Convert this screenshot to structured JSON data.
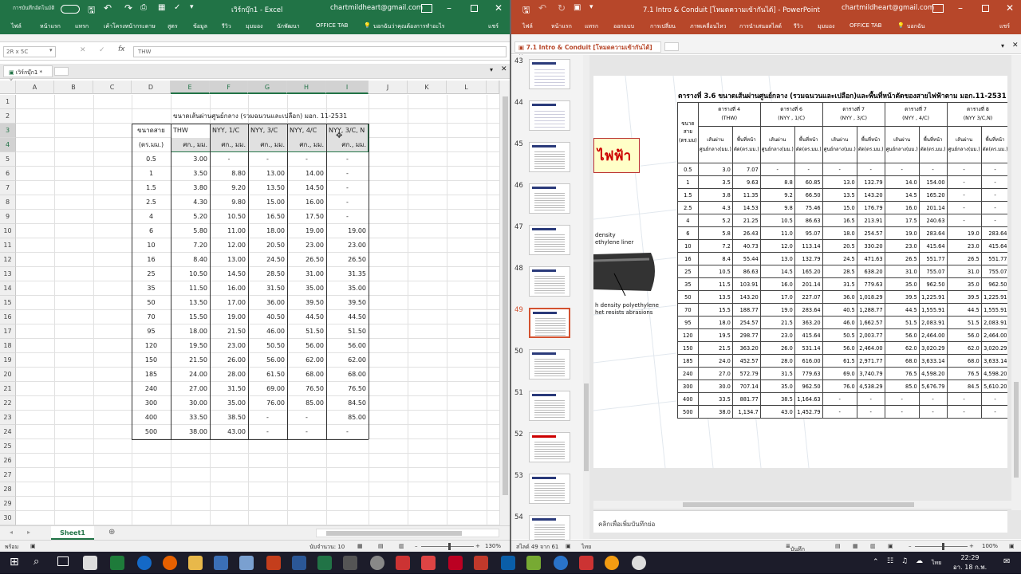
{
  "excel": {
    "title": "เวิร์กบุ๊ก1 - Excel",
    "autosave": "การบันทึกอัตโนมัติ",
    "account": "chartmildheart@gmail.com",
    "tabs": [
      "ไฟล์",
      "หน้าแรก",
      "แทรก",
      "เค้าโครงหน้ากระดาษ",
      "สูตร",
      "ข้อมูล",
      "รีวิว",
      "มุมมอง",
      "นักพัฒนา",
      "OFFICE TAB"
    ],
    "tellme": "บอกฉันว่าคุณต้องการทำอะไร",
    "share": "แชร์",
    "namebox": "2R x 5C",
    "formula": "THW",
    "workbook_tab": "เวิร์กบุ๊ก1 *",
    "columns": [
      "A",
      "B",
      "C",
      "D",
      "E",
      "F",
      "G",
      "H",
      "I",
      "J",
      "K",
      "L"
    ],
    "rows": [
      "1",
      "2",
      "3",
      "4",
      "5",
      "6",
      "7",
      "8",
      "9",
      "10",
      "11",
      "12",
      "13",
      "14",
      "15",
      "16",
      "17",
      "18",
      "19",
      "20",
      "21",
      "22",
      "23",
      "24",
      "25",
      "26",
      "27",
      "28",
      "29",
      "30"
    ],
    "sheet_title": "ขนาดเส้นผ่านศูนย์กลาง (รวมฉนวนและเปลือก) มอก. 11-2531",
    "header_size": "ขนาดสาย",
    "header_unit": "(ตร.มม.)",
    "header_types": [
      "THW",
      "NYY, 1/C",
      "NYY, 3/C",
      "NYY, 4/C",
      "NYY, 3/C, N"
    ],
    "header_subunit": "ศก., มม.",
    "data_rows": [
      [
        "0.5",
        "3.00",
        "-",
        "-",
        "-",
        "-"
      ],
      [
        "1",
        "3.50",
        "8.80",
        "13.00",
        "14.00",
        "-"
      ],
      [
        "1.5",
        "3.80",
        "9.20",
        "13.50",
        "14.50",
        "-"
      ],
      [
        "2.5",
        "4.30",
        "9.80",
        "15.00",
        "16.00",
        "-"
      ],
      [
        "4",
        "5.20",
        "10.50",
        "16.50",
        "17.50",
        "-"
      ],
      [
        "6",
        "5.80",
        "11.00",
        "18.00",
        "19.00",
        "19.00"
      ],
      [
        "10",
        "7.20",
        "12.00",
        "20.50",
        "23.00",
        "23.00"
      ],
      [
        "16",
        "8.40",
        "13.00",
        "24.50",
        "26.50",
        "26.50"
      ],
      [
        "25",
        "10.50",
        "14.50",
        "28.50",
        "31.00",
        "31.35"
      ],
      [
        "35",
        "11.50",
        "16.00",
        "31.50",
        "35.00",
        "35.00"
      ],
      [
        "50",
        "13.50",
        "17.00",
        "36.00",
        "39.50",
        "39.50"
      ],
      [
        "70",
        "15.50",
        "19.00",
        "40.50",
        "44.50",
        "44.50"
      ],
      [
        "95",
        "18.00",
        "21.50",
        "46.00",
        "51.50",
        "51.50"
      ],
      [
        "120",
        "19.50",
        "23.00",
        "50.50",
        "56.00",
        "56.00"
      ],
      [
        "150",
        "21.50",
        "26.00",
        "56.00",
        "62.00",
        "62.00"
      ],
      [
        "185",
        "24.00",
        "28.00",
        "61.50",
        "68.00",
        "68.00"
      ],
      [
        "240",
        "27.00",
        "31.50",
        "69.00",
        "76.50",
        "76.50"
      ],
      [
        "300",
        "30.00",
        "35.00",
        "76.00",
        "85.00",
        "84.50"
      ],
      [
        "400",
        "33.50",
        "38.50",
        "-",
        "-",
        "85.00"
      ],
      [
        "500",
        "38.00",
        "43.00",
        "-",
        "-",
        "-"
      ]
    ],
    "sheet_tab": "Sheet1",
    "status_ready": "พร้อม",
    "status_count": "นับจำนวน: 10",
    "zoom": "130%"
  },
  "ppt": {
    "title": "7.1 Intro & Conduit [โหมดความเข้ากันได้] - PowerPoint",
    "account": "chartmildheart@gmail.com",
    "tabs": [
      "ไฟล์",
      "หน้าแรก",
      "แทรก",
      "ออกแบบ",
      "การเปลี่ยน",
      "ภาพเคลื่อนไหว",
      "การนำเสนอสไลด์",
      "รีวิว",
      "มุมมอง",
      "OFFICE TAB"
    ],
    "tellme": "บอกฉัน",
    "share": "แชร์",
    "doc_tab": "7.1 Intro & Conduit [โหมดความเข้ากันได้]",
    "thumb_numbers": [
      "43",
      "44",
      "45",
      "46",
      "47",
      "48",
      "49",
      "50",
      "51",
      "52",
      "53",
      "54"
    ],
    "slide_title": "ตารางที่ 3.6 ขนาดเส้นผ่านศูนย์กลาง (รวมฉนวนและเปลือก)และพื้นที่หน้าตัดของสายไฟฟ้าตาม มอก.11-2531",
    "slide_fragment_red": "ไฟฟ้า",
    "slide_fragment_1a": "density",
    "slide_fragment_1b": "ethylene liner",
    "slide_fragment_2a": "h density polyethylene",
    "slide_fragment_2b": "het resists abrasions",
    "table_size_header": "ขนาดสาย",
    "table_size_unit": "(ตร.มม)",
    "table_groups": [
      {
        "name": "ตารางที่ 4",
        "type": "(THW)"
      },
      {
        "name": "ตารางที่ 6",
        "type": "(NYY , 1/C)"
      },
      {
        "name": "ตารางที่ 7",
        "type": "(NYY , 3/C)"
      },
      {
        "name": "ตารางที่ 7",
        "type": "(NYY , 4/C)"
      },
      {
        "name": "ตารางที่ 8",
        "type": "(NYY 3/C,N)"
      }
    ],
    "sub_diam": "เส้นผ่านศูนย์กลาง(มม.)",
    "sub_area": "พื้นที่หน้าตัด(ตร.มม.)",
    "table_rows": [
      [
        "0.5",
        "3.0",
        "7.07",
        "-",
        "-",
        "-",
        "-",
        "-",
        "-",
        "-",
        "-"
      ],
      [
        "1",
        "3.5",
        "9.63",
        "8.8",
        "60.85",
        "13.0",
        "132.79",
        "14.0",
        "154.00",
        "-",
        "-"
      ],
      [
        "1.5",
        "3.8",
        "11.35",
        "9.2",
        "66.50",
        "13.5",
        "143.20",
        "14.5",
        "165.20",
        "-",
        "-"
      ],
      [
        "2.5",
        "4.3",
        "14.53",
        "9.8",
        "75.46",
        "15.0",
        "176.79",
        "16.0",
        "201.14",
        "-",
        "-"
      ],
      [
        "4",
        "5.2",
        "21.25",
        "10.5",
        "86.63",
        "16.5",
        "213.91",
        "17.5",
        "240.63",
        "-",
        "-"
      ],
      [
        "6",
        "5.8",
        "26.43",
        "11.0",
        "95.07",
        "18.0",
        "254.57",
        "19.0",
        "283.64",
        "19.0",
        "283.64"
      ],
      [
        "10",
        "7.2",
        "40.73",
        "12.0",
        "113.14",
        "20.5",
        "330.20",
        "23.0",
        "415.64",
        "23.0",
        "415.64"
      ],
      [
        "16",
        "8.4",
        "55.44",
        "13.0",
        "132.79",
        "24.5",
        "471.63",
        "26.5",
        "551.77",
        "26.5",
        "551.77"
      ],
      [
        "25",
        "10.5",
        "86.63",
        "14.5",
        "165.20",
        "28.5",
        "638.20",
        "31.0",
        "755.07",
        "31.0",
        "755.07"
      ],
      [
        "35",
        "11.5",
        "103.91",
        "16.0",
        "201.14",
        "31.5",
        "779.63",
        "35.0",
        "962.50",
        "35.0",
        "962.50"
      ],
      [
        "50",
        "13.5",
        "143.20",
        "17.0",
        "227.07",
        "36.0",
        "1,018.29",
        "39.5",
        "1,225.91",
        "39.5",
        "1,225.91"
      ],
      [
        "70",
        "15.5",
        "188.77",
        "19.0",
        "283.64",
        "40.5",
        "1,288.77",
        "44.5",
        "1,555.91",
        "44.5",
        "1,555.91"
      ],
      [
        "95",
        "18.0",
        "254.57",
        "21.5",
        "363.20",
        "46.0",
        "1,662.57",
        "51.5",
        "2,083.91",
        "51.5",
        "2,083.91"
      ],
      [
        "120",
        "19.5",
        "298.77",
        "23.0",
        "415.64",
        "50.5",
        "2,003.77",
        "56.0",
        "2,464.00",
        "56.0",
        "2,464.00"
      ],
      [
        "150",
        "21.5",
        "363.20",
        "26.0",
        "531.14",
        "56.0",
        "2,464.00",
        "62.0",
        "3,020.29",
        "62.0",
        "3,020.29"
      ],
      [
        "185",
        "24.0",
        "452.57",
        "28.0",
        "616.00",
        "61.5",
        "2,971.77",
        "68.0",
        "3,633.14",
        "68.0",
        "3,633.14"
      ],
      [
        "240",
        "27.0",
        "572.79",
        "31.5",
        "779.63",
        "69.0",
        "3,740.79",
        "76.5",
        "4,598.20",
        "76.5",
        "4,598.20"
      ],
      [
        "300",
        "30.0",
        "707.14",
        "35.0",
        "962.50",
        "76.0",
        "4,538.29",
        "85.0",
        "5,676.79",
        "84.5",
        "5,610.20"
      ],
      [
        "400",
        "33.5",
        "881.77",
        "38.5",
        "1,164.63",
        "-",
        "-",
        "-",
        "-",
        "-",
        "-"
      ],
      [
        "500",
        "38.0",
        "1,134.7",
        "43.0",
        "1,452.79",
        "-",
        "-",
        "-",
        "-",
        "-",
        "-"
      ]
    ],
    "notes_placeholder": "คลิกเพื่อเพิ่มบันทึกย่อ",
    "status_slide": "สไลด์ 49 จาก 61",
    "status_lang": "ไทย",
    "status_notes": "บันทึกย่อ",
    "zoom": "100%"
  },
  "taskbar": {
    "time": "22:29",
    "date": "อา. 18 ก.พ. 2561",
    "lang": "ไทย"
  }
}
